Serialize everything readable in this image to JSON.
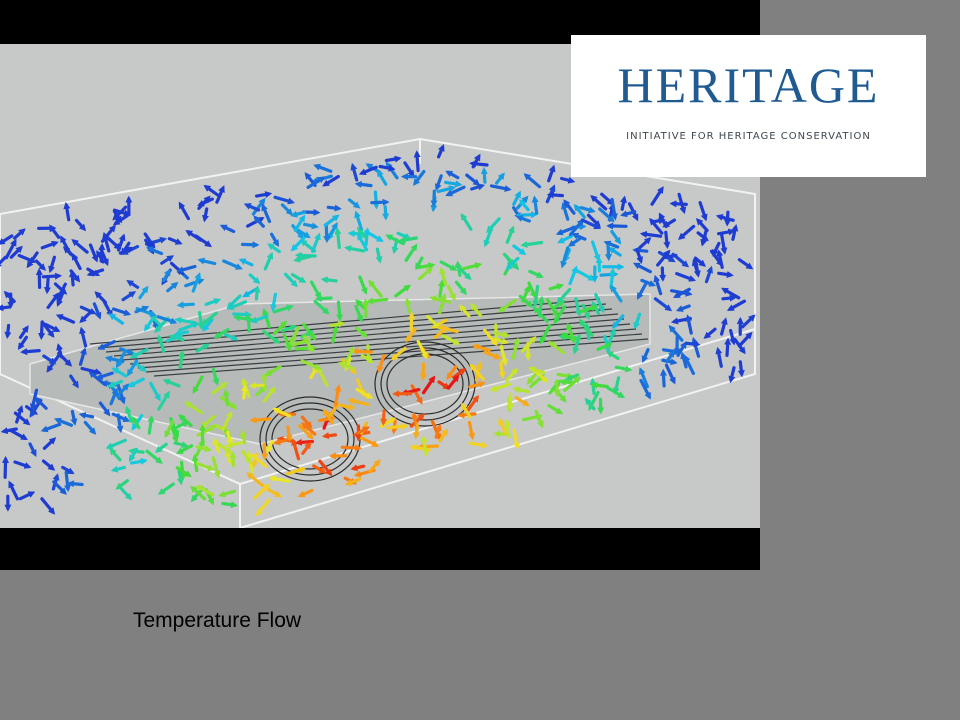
{
  "logo": {
    "wordmark": "HERITAGE",
    "tagline": "INITIATIVE FOR HERITAGE CONSERVATION",
    "color": "#1f5a91"
  },
  "caption": "Temperature Flow",
  "colors": {
    "background": "#808080",
    "letterbox": "#000000",
    "sim_background": "#c6c9c8"
  }
}
